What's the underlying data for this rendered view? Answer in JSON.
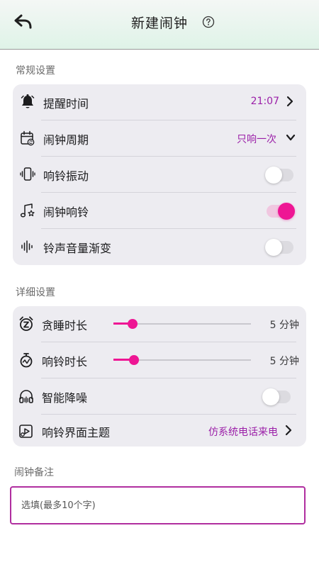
{
  "header": {
    "title": "新建闹钟",
    "back_icon": "back-arrow-icon",
    "help_icon": "question-circle-icon"
  },
  "sections": {
    "general": "常规设置",
    "detail": "详细设置",
    "note": "闹钟备注"
  },
  "general": {
    "remind_time": {
      "label": "提醒时间",
      "value": "21:07",
      "icon": "bell-icon"
    },
    "cycle": {
      "label": "闹钟周期",
      "value": "只响一次",
      "icon": "calendar-repeat-icon"
    },
    "vibrate": {
      "label": "响铃振动",
      "on": false,
      "icon": "phone-vibrate-icon"
    },
    "ringtone": {
      "label": "闹钟响铃",
      "on": true,
      "icon": "music-note-icon"
    },
    "fade_in": {
      "label": "铃声音量渐变",
      "on": false,
      "icon": "sound-wave-icon"
    }
  },
  "detail": {
    "snooze": {
      "label": "贪睡时长",
      "value": "5 分钟",
      "slider_fraction": 0.14,
      "icon": "snooze-alarm-icon"
    },
    "ring_duration": {
      "label": "响铃时长",
      "value": "5 分钟",
      "slider_fraction": 0.15,
      "icon": "timer-icon"
    },
    "noise_reduction": {
      "label": "智能降噪",
      "on": false,
      "icon": "headphones-icon"
    },
    "theme": {
      "label": "响铃界面主题",
      "value": "仿系统电话来电",
      "icon": "theme-play-icon"
    }
  },
  "note": {
    "placeholder": "选填(最多10个字)",
    "value": ""
  },
  "colors": {
    "accent": "#ee1694",
    "value_text": "#9b1fa8",
    "note_border": "#b02e9f",
    "card_bg": "#edecf1"
  }
}
